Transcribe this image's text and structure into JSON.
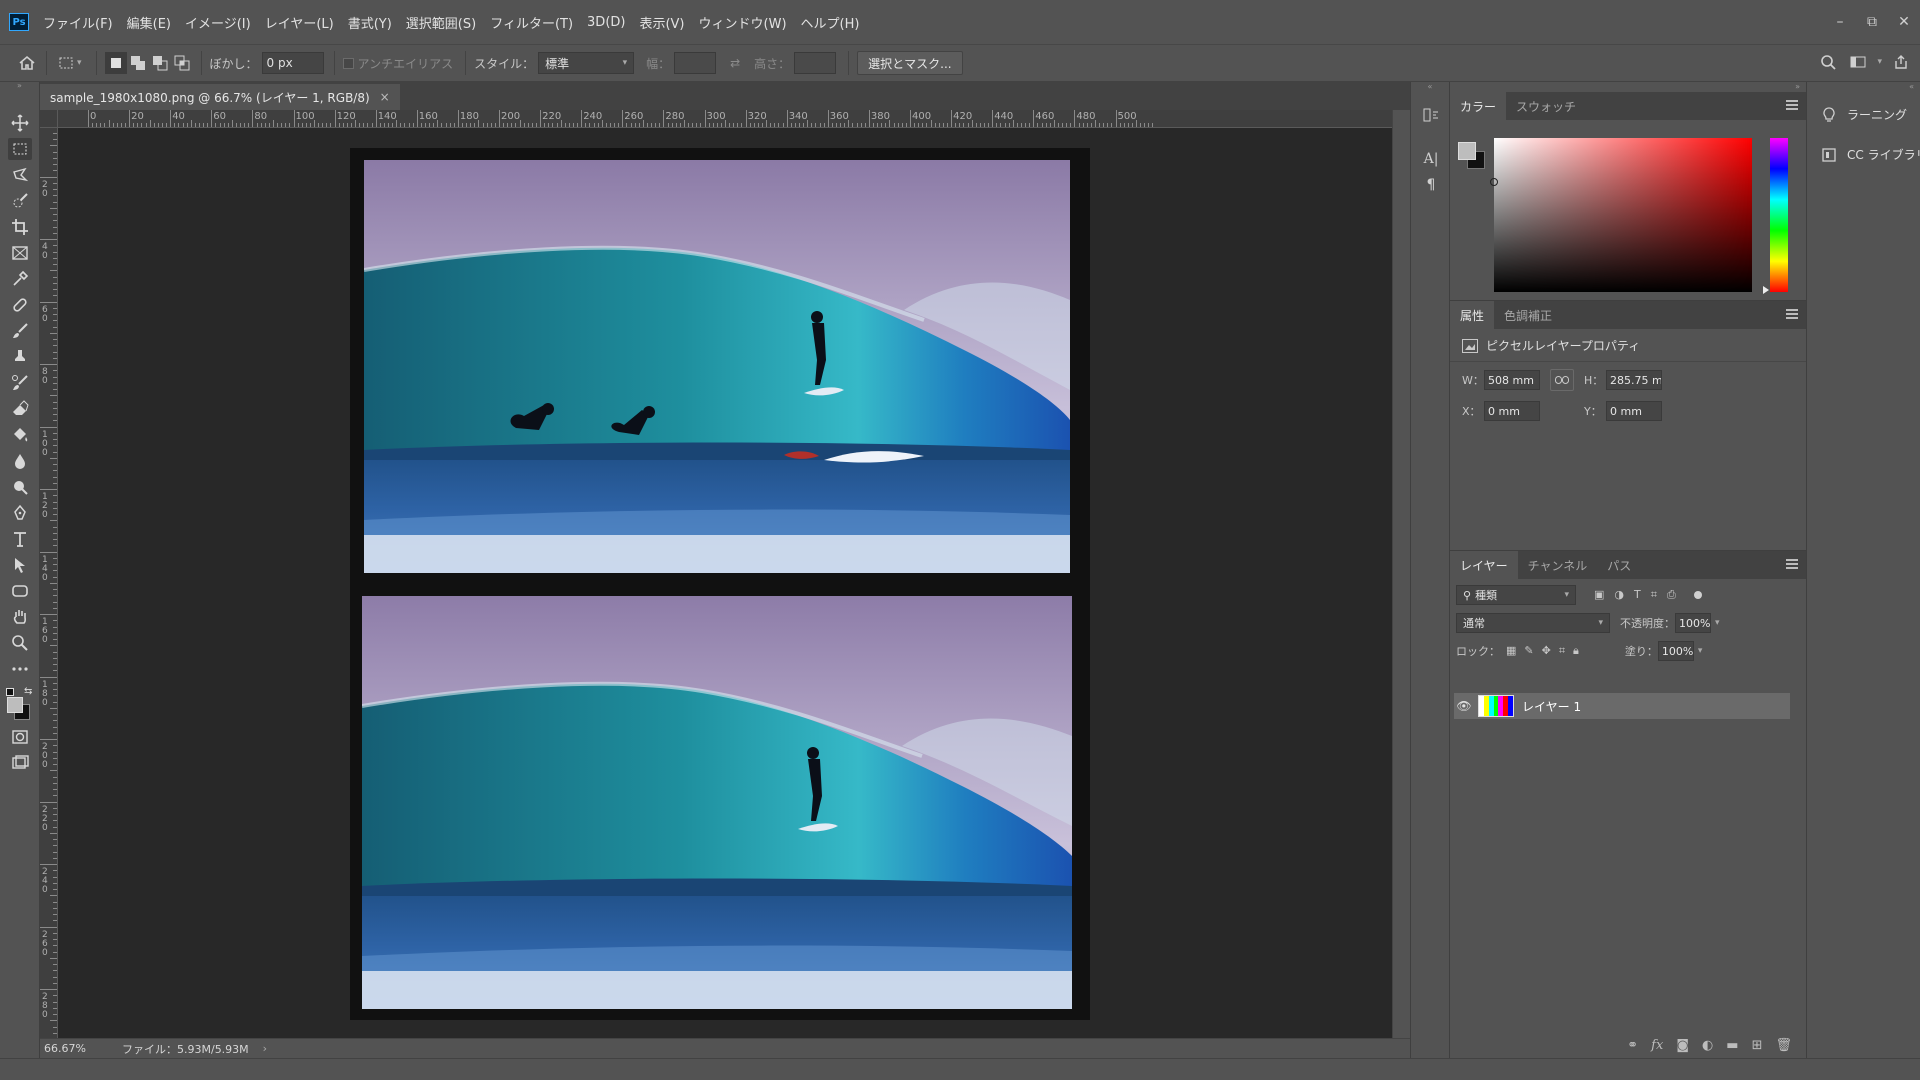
{
  "app": {
    "logo": "Ps"
  },
  "menu": [
    "ファイル(F)",
    "編集(E)",
    "イメージ(I)",
    "レイヤー(L)",
    "書式(Y)",
    "選択範囲(S)",
    "フィルター(T)",
    "3D(D)",
    "表示(V)",
    "ウィンドウ(W)",
    "ヘルプ(H)"
  ],
  "window_controls": {
    "minimize": "–",
    "restore": "⧉",
    "close": "✕"
  },
  "options": {
    "feather_label": "ぼかし：",
    "feather_value": "0 px",
    "antialias_label": "アンチエイリアス",
    "style_label": "スタイル：",
    "style_value": "標準",
    "width_label": "幅：",
    "height_label": "高さ：",
    "select_mask_button": "選択とマスク..."
  },
  "document": {
    "tab_title": "sample_1980x1080.png @ 66.7% (レイヤー 1, RGB/8)",
    "tab_close": "×",
    "zoom": "66.67%",
    "file_info": "ファイル：5.93M/5.93M",
    "status_arrow": "›"
  },
  "ruler": {
    "h_labels": [
      "0",
      "20",
      "40",
      "60",
      "80",
      "100",
      "120",
      "140",
      "160",
      "180",
      "200",
      "220",
      "240",
      "260",
      "280",
      "300",
      "320",
      "340",
      "360",
      "380",
      "400",
      "420",
      "440",
      "460",
      "480",
      "500"
    ],
    "v_labels": [
      "0",
      "20",
      "40",
      "60",
      "80",
      "100",
      "120",
      "140",
      "160",
      "180",
      "200",
      "220",
      "240",
      "260",
      "280"
    ]
  },
  "color_panel": {
    "tabs": [
      "カラー",
      "スウォッチ"
    ],
    "foreground": "#bdbdbd",
    "background": "#111111"
  },
  "properties_panel": {
    "tabs": [
      "属性",
      "色調補正"
    ],
    "heading": "ピクセルレイヤープロパティ",
    "w_label": "W：",
    "w_value": "508 mm",
    "h_label": "H：",
    "h_value": "285.75 mm",
    "x_label": "X：",
    "x_value": "0 mm",
    "y_label": "Y：",
    "y_value": "0 mm"
  },
  "layers_panel": {
    "tabs": [
      "レイヤー",
      "チャンネル",
      "パス"
    ],
    "filter_value": "種類",
    "blend_mode": "通常",
    "opacity_label": "不透明度：",
    "opacity_value": "100%",
    "lock_label": "ロック：",
    "fill_label": "塗り：",
    "fill_value": "100%",
    "layers": [
      {
        "name": "レイヤー 1",
        "visible": true
      }
    ],
    "footer_icons": [
      "link-icon",
      "fx-icon",
      "mask-icon",
      "adjustment-icon",
      "folder-icon",
      "new-layer-icon",
      "trash-icon"
    ]
  },
  "far_right": {
    "learn": "ラーニング",
    "libraries": "CC ライブラリ"
  }
}
